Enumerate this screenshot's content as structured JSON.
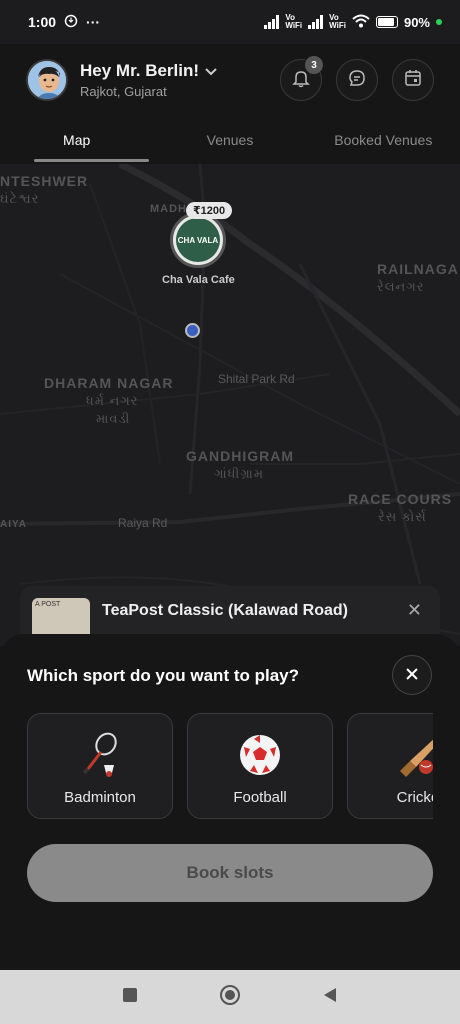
{
  "status_bar": {
    "time": "1:00",
    "more": "···",
    "vowifi_1": "Vo\nWiFi",
    "vowifi_2": "Vo\nWiFi",
    "battery": "90%"
  },
  "header": {
    "greeting": "Hey Mr. Berlin!",
    "location": "Rajkot, Gujarat",
    "notification_count": "3"
  },
  "tabs": [
    {
      "label": "Map"
    },
    {
      "label": "Venues"
    },
    {
      "label": "Booked Venues"
    }
  ],
  "map": {
    "labels": {
      "teshwer": "NTESHWER",
      "teshwer_guj": "ઘંટેશ્વર",
      "madh": "MADH",
      "railnagar": "RAILNAGA",
      "railnagar_guj": "રેલનગર",
      "dharam": "DHARAM NAGAR",
      "dharam_guj1": "ધર્મ નગર",
      "dharam_guj2": "માવડી",
      "shital": "Shital Park Rd",
      "gandhigram": "GANDHIGRAM",
      "gandhigram_guj": "ગાંધીગ્રામ",
      "race": "RACE COURS",
      "race_guj": "રેસ કોર્સ",
      "aiya": "AIYA",
      "raiya_rd": "Raiya Rd"
    },
    "pin": {
      "price": "₹1200",
      "logo_text": "CHA VALA",
      "name": "Cha Vala Cafe"
    }
  },
  "venue_card": {
    "name": "TeaPost Classic (Kalawad Road)",
    "thumb_text": "A POST"
  },
  "sheet": {
    "title": "Which sport do you want to play?",
    "sports": [
      {
        "label": "Badminton"
      },
      {
        "label": "Football"
      },
      {
        "label": "Cricket"
      }
    ],
    "book_label": "Book slots"
  },
  "colors": {
    "background": "#161616",
    "book_button": "#8a8a8a"
  }
}
